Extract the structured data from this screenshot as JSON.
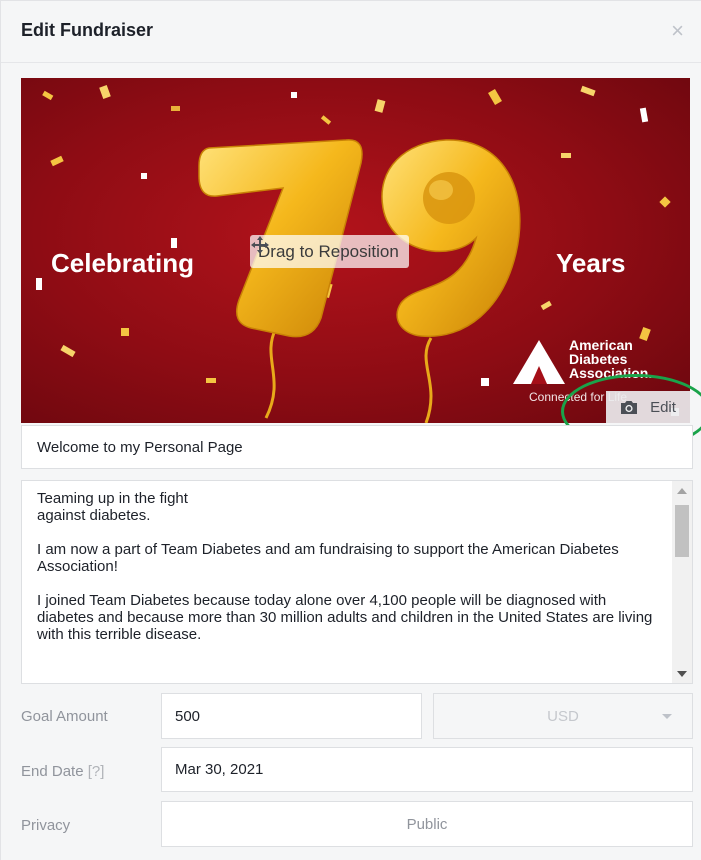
{
  "dialog": {
    "title": "Edit Fundraiser",
    "close_glyph": "×"
  },
  "cover": {
    "left_text": "Celebrating",
    "right_text": "Years",
    "number_text": "79",
    "drag_label": "Drag to Reposition",
    "logo_lines": [
      "American",
      "Diabetes",
      "Association."
    ],
    "logo_tagline": "Connected for Life",
    "edit_label": "Edit",
    "icons": {
      "move": "move-arrows-icon",
      "camera": "camera-icon"
    }
  },
  "form": {
    "headline_value": "Welcome to my Personal Page",
    "story_paragraphs": [
      "Teaming up in the fight\nagainst diabetes.",
      "I am now a part of Team Diabetes and am fundraising to support the American Diabetes Association!",
      "I joined Team Diabetes because today alone over 4,100 people will be diagnosed with\ndiabetes and because more than 30 million adults and children in the United States are living with this terrible disease."
    ],
    "goal_label": "Goal Amount",
    "goal_value": "500",
    "currency_value": "USD",
    "end_date_label": "End Date",
    "end_date_hint": "[?]",
    "end_date_value": "Mar 30, 2021",
    "privacy_label": "Privacy",
    "privacy_value": "Public"
  },
  "colors": {
    "cover_red": "#a50f18",
    "gold": "#f2b31b",
    "highlight_green": "#1aa34a"
  }
}
